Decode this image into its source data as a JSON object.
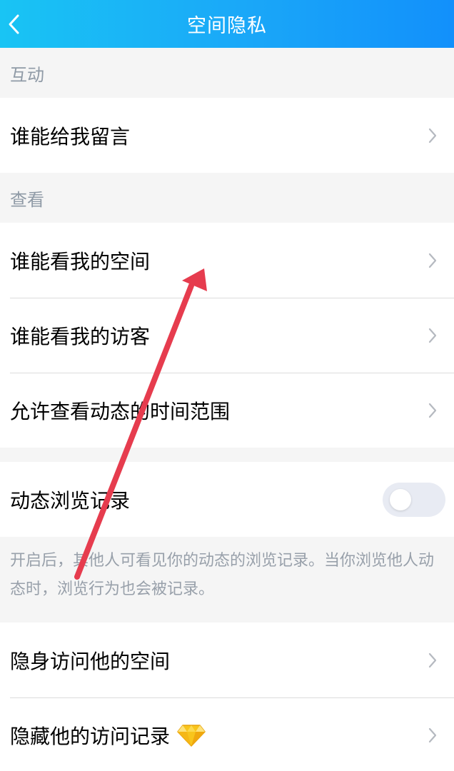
{
  "header": {
    "title": "空间隐私"
  },
  "sections": {
    "interaction": {
      "label": "互动",
      "items": [
        {
          "label": "谁能给我留言"
        }
      ]
    },
    "view": {
      "label": "查看",
      "items": [
        {
          "label": "谁能看我的空间"
        },
        {
          "label": "谁能看我的访客"
        },
        {
          "label": "允许查看动态的时间范围"
        }
      ]
    },
    "browse": {
      "toggle_label": "动态浏览记录",
      "toggle_on": false,
      "description": "开启后，其他人可看见你的动态的浏览记录。当你浏览他人动态时，浏览行为也会被记录。"
    },
    "stealth": {
      "items": [
        {
          "label": "隐身访问他的空间"
        },
        {
          "label": "隐藏他的访问记录",
          "icon": "diamond-icon"
        }
      ]
    }
  },
  "colors": {
    "header_start": "#19c4f4",
    "header_end": "#1290fb",
    "annotation_arrow": "#e63c4e"
  }
}
